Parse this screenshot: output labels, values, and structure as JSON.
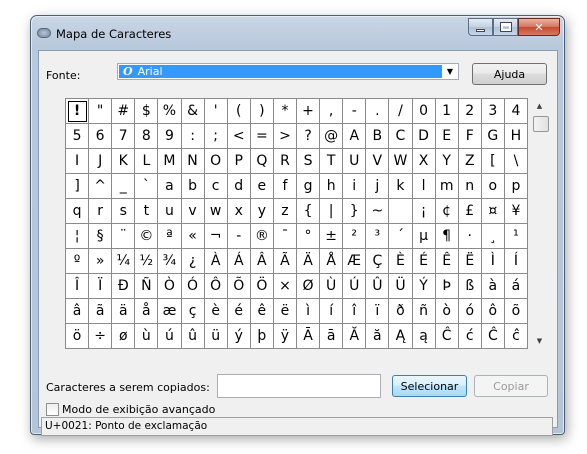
{
  "window": {
    "title": "Mapa de Caracteres",
    "icon": "charmap-icon",
    "controls": [
      "minimize",
      "maximize",
      "close"
    ]
  },
  "font": {
    "label": "Fonte:",
    "selected": "Arial",
    "type_icon": "O"
  },
  "buttons": {
    "help": "Ajuda",
    "select": "Selecionar",
    "copy": "Copiar"
  },
  "copy_section": {
    "label": "Caracteres a serem copiados:",
    "value": ""
  },
  "advanced": {
    "label": "Modo de exibição avançado",
    "checked": false
  },
  "status_text": "U+0021: Ponto de exclamação",
  "grid": {
    "selected_index": 0,
    "rows": [
      [
        "!",
        "\"",
        "#",
        "$",
        "%",
        "&",
        "'",
        "(",
        ")",
        "*",
        "+",
        ",",
        "-",
        ".",
        "/",
        "0",
        "1",
        "2",
        "3",
        "4"
      ],
      [
        "5",
        "6",
        "7",
        "8",
        "9",
        ":",
        ";",
        "<",
        "=",
        ">",
        "?",
        "@",
        "A",
        "B",
        "C",
        "D",
        "E",
        "F",
        "G",
        "H"
      ],
      [
        "I",
        "J",
        "K",
        "L",
        "M",
        "N",
        "O",
        "P",
        "Q",
        "R",
        "S",
        "T",
        "U",
        "V",
        "W",
        "X",
        "Y",
        "Z",
        "[",
        "\\"
      ],
      [
        "]",
        "^",
        "_",
        "`",
        "a",
        "b",
        "c",
        "d",
        "e",
        "f",
        "g",
        "h",
        "i",
        "j",
        "k",
        "l",
        "m",
        "n",
        "o",
        "p"
      ],
      [
        "q",
        "r",
        "s",
        "t",
        "u",
        "v",
        "w",
        "x",
        "y",
        "z",
        "{",
        "|",
        "}",
        "~",
        " ",
        "¡",
        "¢",
        "£",
        "¤",
        "¥"
      ],
      [
        "¦",
        "§",
        "¨",
        "©",
        "ª",
        "«",
        "¬",
        "-",
        "®",
        "¯",
        "°",
        "±",
        "²",
        "³",
        "´",
        "µ",
        "¶",
        "·",
        "¸",
        "¹"
      ],
      [
        "º",
        "»",
        "¼",
        "½",
        "¾",
        "¿",
        "À",
        "Á",
        "Â",
        "Ã",
        "Ä",
        "Å",
        "Æ",
        "Ç",
        "È",
        "É",
        "Ê",
        "Ë",
        "Ì",
        "Í"
      ],
      [
        "Î",
        "Ï",
        "Ð",
        "Ñ",
        "Ò",
        "Ó",
        "Ô",
        "Õ",
        "Ö",
        "×",
        "Ø",
        "Ù",
        "Ú",
        "Û",
        "Ü",
        "Ý",
        "Þ",
        "ß",
        "à",
        "á"
      ],
      [
        "â",
        "ã",
        "ä",
        "å",
        "æ",
        "ç",
        "è",
        "é",
        "ê",
        "ë",
        "ì",
        "í",
        "î",
        "ï",
        "ð",
        "ñ",
        "ò",
        "ó",
        "ô",
        "õ"
      ],
      [
        "ö",
        "÷",
        "ø",
        "ù",
        "ú",
        "û",
        "ü",
        "ý",
        "þ",
        "ÿ",
        "Ā",
        "ā",
        "Ă",
        "ă",
        "Ą",
        "ą",
        "Ĉ",
        "ć",
        "Ĉ",
        "ĉ"
      ]
    ]
  },
  "colors": {
    "selection": "#3399ff",
    "select_button_border": "#3c7fb1",
    "close_button": "#c44a30"
  }
}
